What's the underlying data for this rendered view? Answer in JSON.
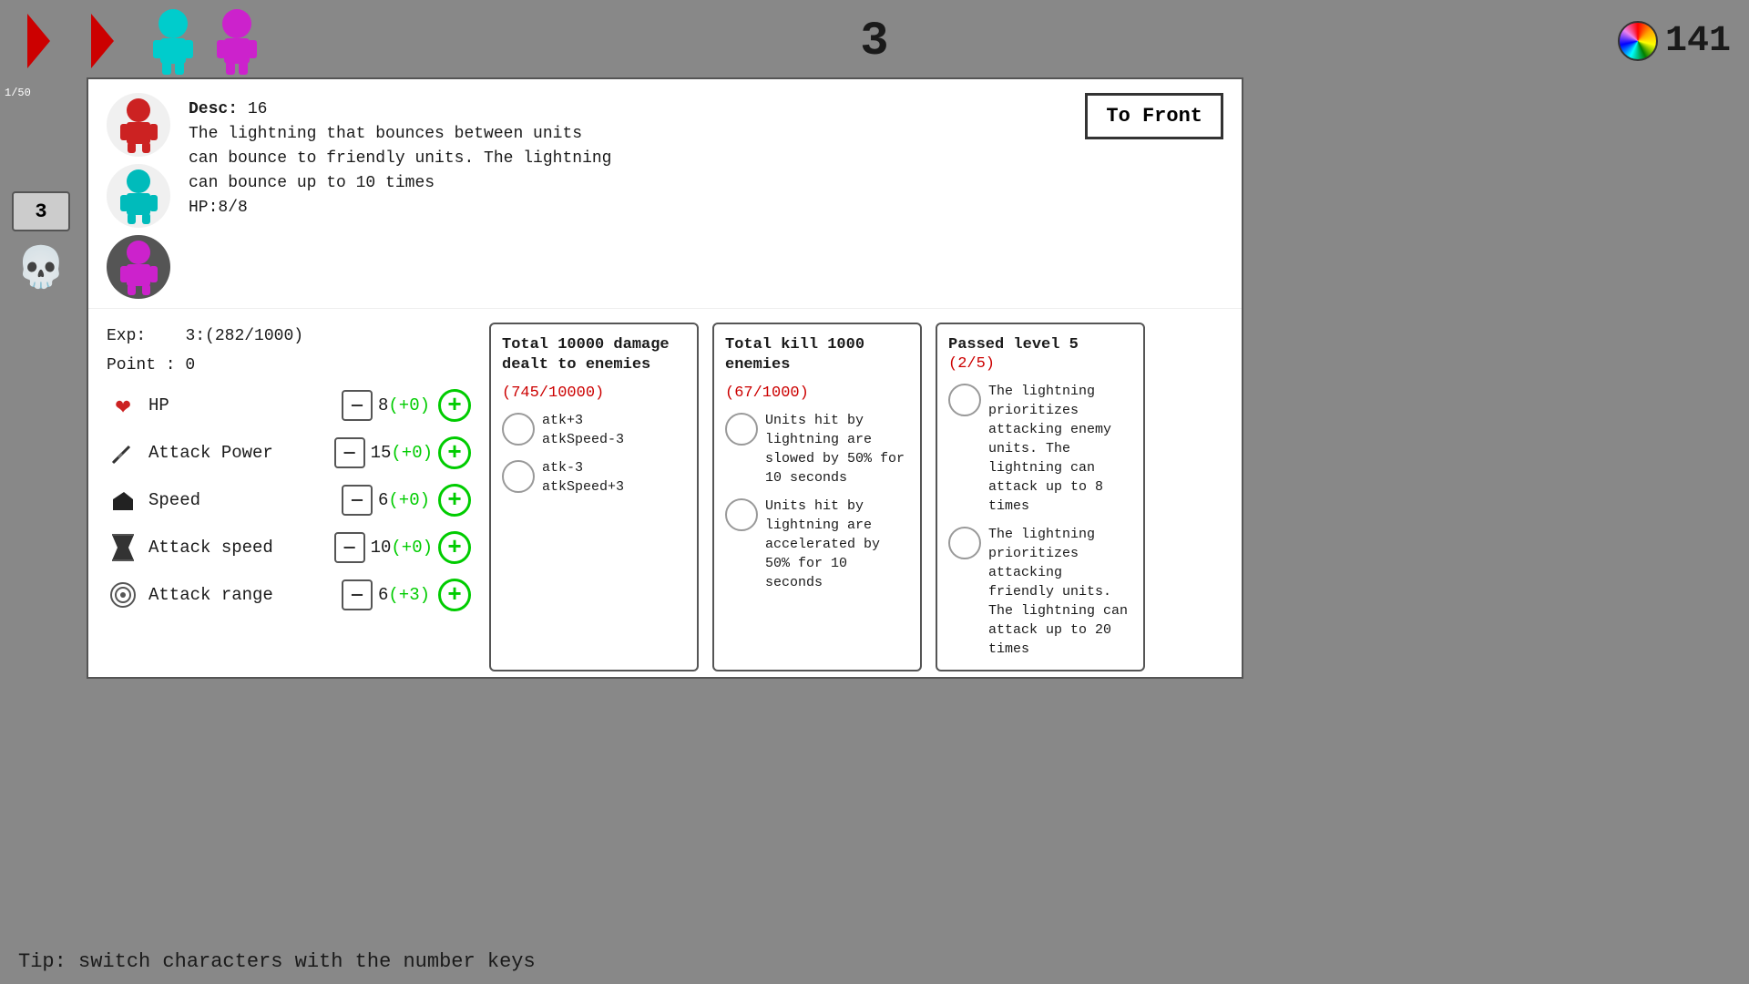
{
  "hud": {
    "wave_number": "3",
    "score": "141",
    "health_current": "1",
    "health_max": "50"
  },
  "players": [
    {
      "color": "red",
      "id": "p1"
    },
    {
      "color": "cyan",
      "id": "p2"
    },
    {
      "color": "magenta",
      "id": "p3"
    }
  ],
  "sidebar": {
    "wave_badge": "3",
    "skull_label": "💀"
  },
  "panel": {
    "to_front_label": "To Front",
    "desc_label": "Desc:",
    "desc_id": "16",
    "desc_text1": "The lightning that bounces between units",
    "desc_text2": "can bounce to friendly units. The lightning",
    "desc_text3": "can bounce up to 10 times",
    "desc_hp": "HP:8/8",
    "exp_label": "Exp:",
    "exp_value": "3:(282/1000)",
    "point_label": "Point : 0",
    "stats": [
      {
        "id": "hp",
        "icon": "❤",
        "label": "HP",
        "value": "8",
        "bonus": "(+0)"
      },
      {
        "id": "attack_power",
        "icon": "⚔",
        "label": "Attack Power",
        "value": "15",
        "bonus": "(+0)"
      },
      {
        "id": "speed",
        "icon": "👟",
        "label": "Speed",
        "value": "6",
        "bonus": "(+0)"
      },
      {
        "id": "attack_speed",
        "icon": "⌛",
        "label": "Attack speed",
        "value": "10",
        "bonus": "(+0)"
      },
      {
        "id": "attack_range",
        "icon": "🎯",
        "label": "Attack range",
        "value": "6",
        "bonus": "(+3)"
      }
    ],
    "cards": [
      {
        "id": "damage_card",
        "title": "Total 10000 damage dealt to enemies",
        "progress": "(745/10000)",
        "options": [
          {
            "text": "atk+3\natkSpeed-3"
          },
          {
            "text": "atk-3\natkSpeed+3"
          }
        ]
      },
      {
        "id": "kill_card",
        "title": "Total kill 1000 enemies",
        "progress": "(67/1000)",
        "options": [
          {
            "text": "Units hit by lightning are slowed by 50% for 10 seconds"
          },
          {
            "text": "Units hit by lightning are accelerated by 50% for 10 seconds"
          }
        ]
      },
      {
        "id": "level_card",
        "title": "Passed level 5",
        "progress": "(2/5)",
        "options": [
          {
            "text": "The lightning prioritizes attacking enemy units. The lightning can attack up to 8 times"
          },
          {
            "text": "The lightning prioritizes attacking friendly units. The lightning can attack up to 20 times"
          }
        ]
      }
    ]
  },
  "tip": {
    "text": "Tip:   switch characters with the number keys"
  }
}
